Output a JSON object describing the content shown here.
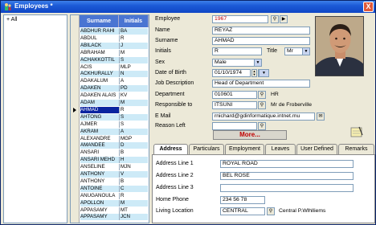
{
  "window": {
    "title": "Employees *",
    "close_label": "X"
  },
  "tree": {
    "root_label": "All"
  },
  "grid": {
    "columns": [
      "Surname",
      "Initials"
    ],
    "rows": [
      {
        "surname": "ABDHUR RAHI",
        "initials": "BA"
      },
      {
        "surname": "ABDUL",
        "initials": "R"
      },
      {
        "surname": "ABILACK",
        "initials": "J"
      },
      {
        "surname": "ABRAHAM",
        "initials": "M"
      },
      {
        "surname": "ACHAKKOTTIL",
        "initials": "S"
      },
      {
        "surname": "ACIS",
        "initials": "MLP"
      },
      {
        "surname": "ACKHURALLY",
        "initials": "N"
      },
      {
        "surname": "ADAKALUM",
        "initials": "A"
      },
      {
        "surname": "ADAKEN",
        "initials": "PD"
      },
      {
        "surname": "ADAKEN ALAIS",
        "initials": "KV"
      },
      {
        "surname": "ADAM",
        "initials": "M"
      },
      {
        "surname": "AHMAD",
        "initials": "R"
      },
      {
        "surname": "AHTONG",
        "initials": "S"
      },
      {
        "surname": "AJMER",
        "initials": "S"
      },
      {
        "surname": "AKRAM",
        "initials": "A"
      },
      {
        "surname": "ALEXANDRE",
        "initials": "MGP"
      },
      {
        "surname": "AMANDEE",
        "initials": "D"
      },
      {
        "surname": "ANSARI",
        "initials": "B"
      },
      {
        "surname": "ANSARI MEHD",
        "initials": "H"
      },
      {
        "surname": "ANSELINE",
        "initials": "MJN"
      },
      {
        "surname": "ANTHONY",
        "initials": "V"
      },
      {
        "surname": "ANTHONY",
        "initials": "B"
      },
      {
        "surname": "ANTOINE",
        "initials": "C"
      },
      {
        "surname": "ANUGANOULA",
        "initials": "R"
      },
      {
        "surname": "APOLLON",
        "initials": "M"
      },
      {
        "surname": "APPASAMY",
        "initials": "MT"
      },
      {
        "surname": "APPASAMY",
        "initials": "JCN"
      }
    ],
    "selected_index": 11
  },
  "form": {
    "employee_label": "Employee",
    "employee_value": "1967",
    "name_label": "Name",
    "name_value": "REYAZ",
    "surname_label": "Surname",
    "surname_value": "AHMAD",
    "initials_label": "Initials",
    "initials_value": "R",
    "title_label": "Title",
    "title_value": "Mr",
    "sex_label": "Sex",
    "sex_value": "Male",
    "dob_label": "Date of Birth",
    "dob_value": "01/10/1974",
    "jobdesc_label": "Job Description",
    "jobdesc_value": "Head of Department",
    "dept_label": "Department",
    "dept_value": "010601",
    "dept_name": "HR",
    "resp_label": "Responsible to",
    "resp_value": "ITSUNI",
    "resp_name": "Mr de Froberville",
    "email_label": "E Mail",
    "email_value": "rnichard@gdinformatique.intnet.mu",
    "reason_label": "Reason Left",
    "more_label": "More..."
  },
  "tabs": {
    "items": [
      "Address",
      "Particulars",
      "Employment",
      "Leaves",
      "User Defined",
      "Remarks"
    ],
    "active": "Address"
  },
  "address": {
    "line1_label": "Address Line 1",
    "line1_value": "ROYAL ROAD",
    "line2_label": "Address Line 2",
    "line2_value": "BEL ROSE",
    "line3_label": "Address Line 3",
    "line3_value": "",
    "phone_label": "Home Phone",
    "phone_value": "234 56 78",
    "location_label": "Living Location",
    "location_value": "CENTRAL",
    "location_name": "Central P.Wlhlliems"
  }
}
